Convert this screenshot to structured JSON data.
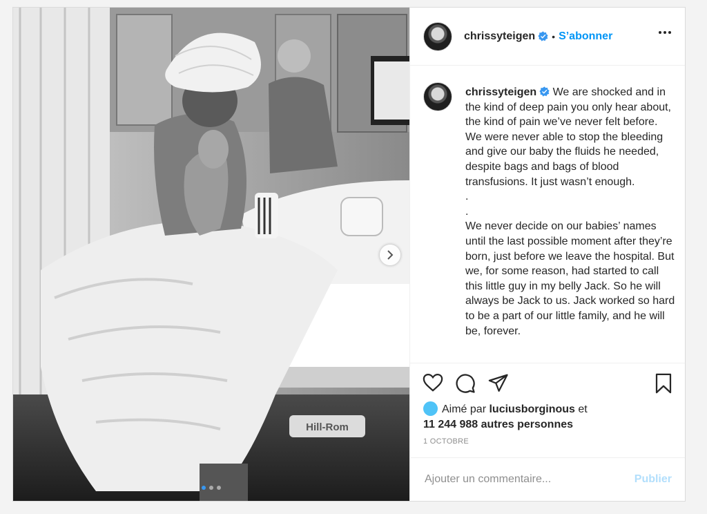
{
  "post": {
    "username": "chrissyteigen",
    "verified": true,
    "follow_label": "S’abonner",
    "bullet": "•",
    "caption_lines": [
      "We are shocked and in the kind of deep pain you only hear about, the kind of pain we’ve never felt before. We were never able to stop the bleeding and give our baby the fluids he needed, despite bags and bags of blood transfusions. It just wasn’t enough.",
      ".",
      ".",
      "We never decide on our babies’ names until the last possible moment after they’re born, just before we leave the hospital.  But we, for some reason, had started to call this little guy in my belly Jack.  So he will always be Jack to us.  Jack worked so hard to be a part of our little family, and he will be, forever."
    ],
    "likes": {
      "prefix": "Aimé par",
      "liker": "luciusborginous",
      "connector": "et",
      "others": "11 244 988 autres personnes"
    },
    "date": "1 OCTOBRE",
    "comment_placeholder": "Ajouter un commentaire...",
    "publish_label": "Publier",
    "photo_overlay_text": "Hill-Rom",
    "carousel": {
      "total": 3,
      "active_index": 0
    }
  },
  "icons": {
    "verified": "verified-badge-icon",
    "more": "more-options-icon",
    "like": "heart-icon",
    "comment": "comment-bubble-icon",
    "share": "paper-plane-icon",
    "save": "bookmark-icon",
    "next": "chevron-right-icon"
  },
  "colors": {
    "accent": "#0095f6",
    "verified_badge": "#3897f0",
    "publish_disabled": "#b2dffc",
    "muted_text": "#8e8e8e",
    "liker_avatar": "#4fc3f7"
  }
}
